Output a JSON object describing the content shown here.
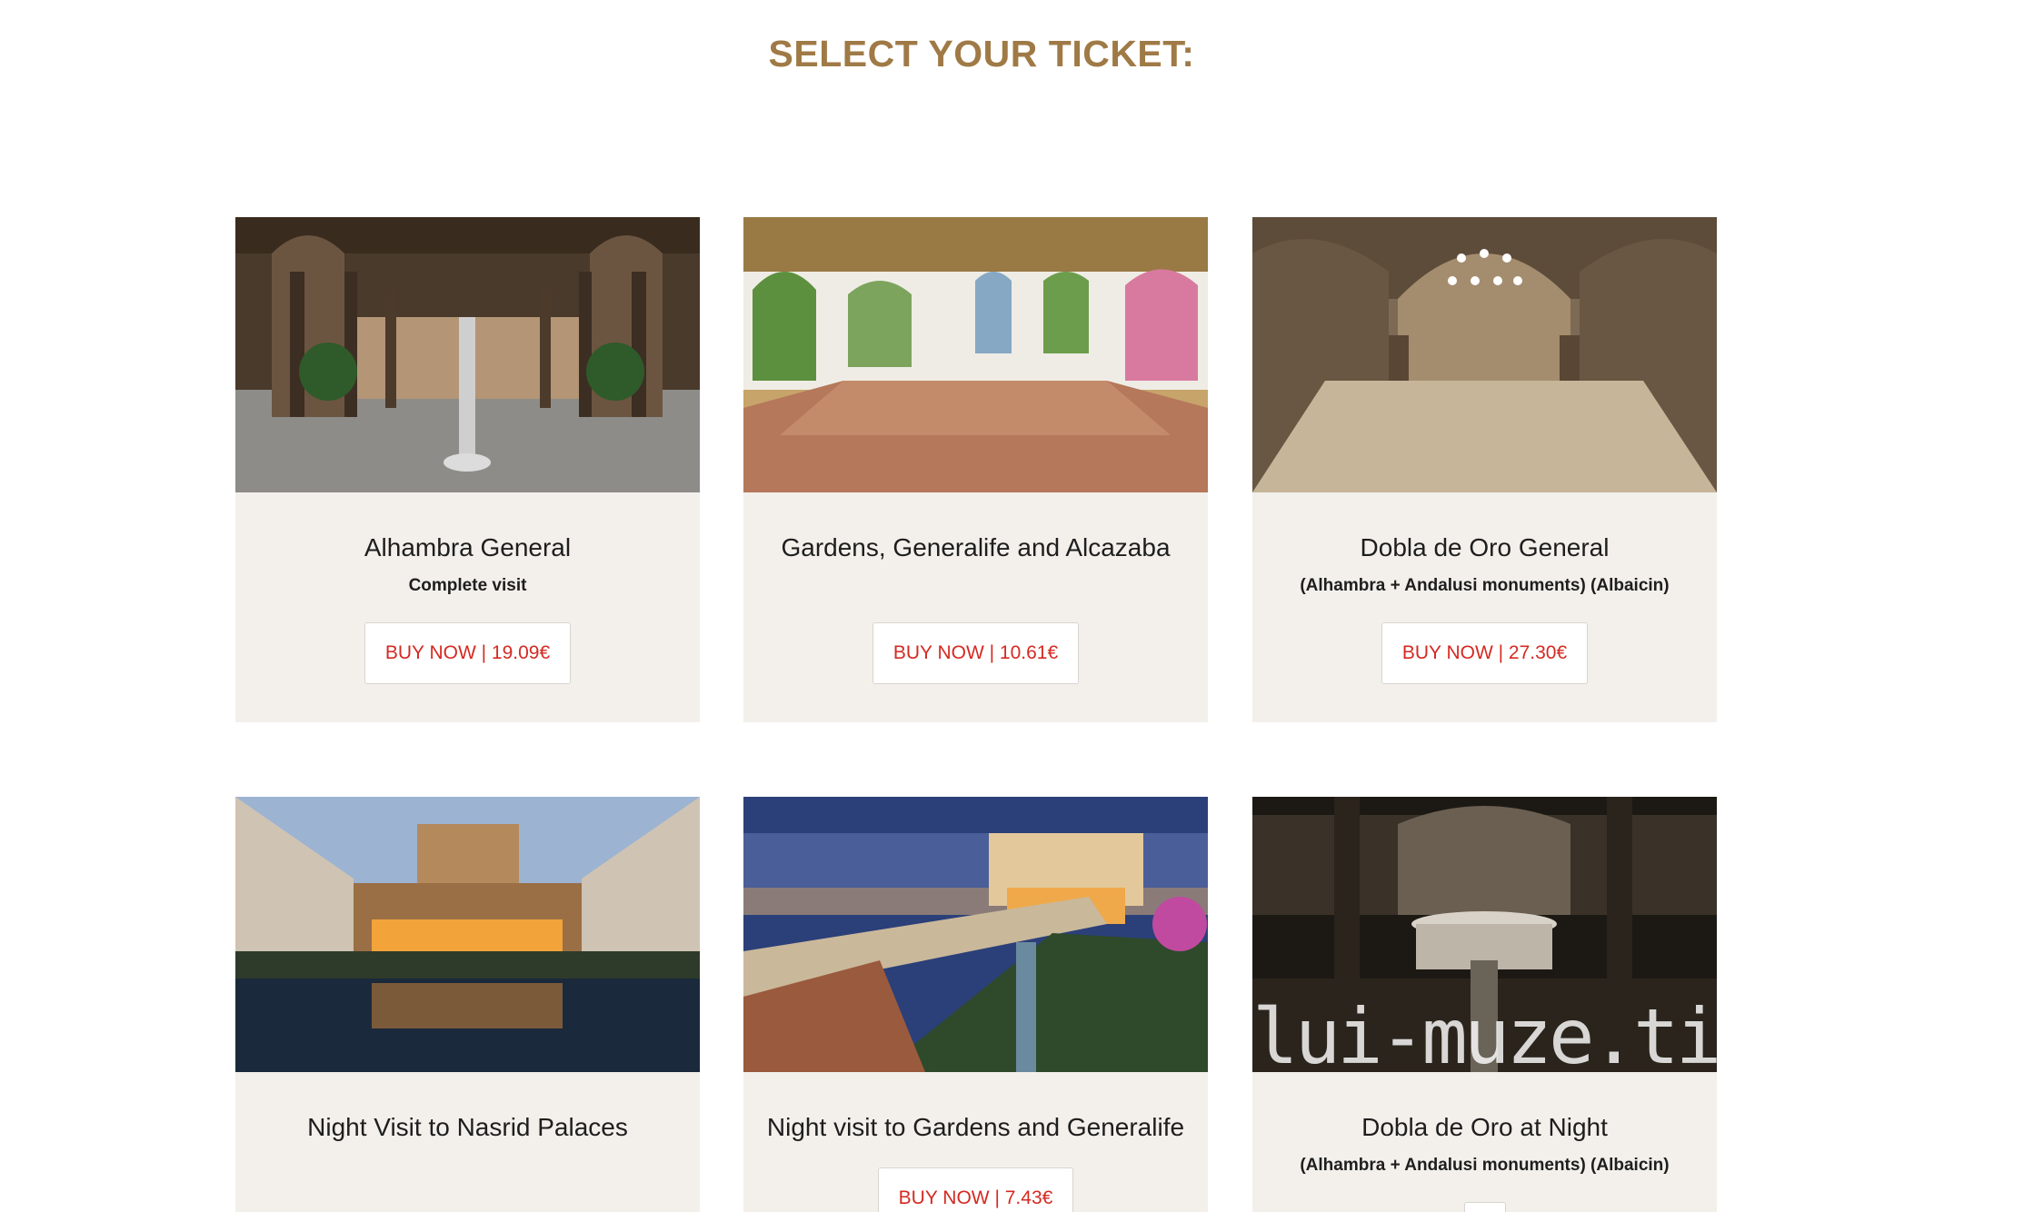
{
  "page": {
    "heading": "SELECT YOUR TICKET:"
  },
  "cards": [
    {
      "title": "Alhambra General",
      "subtitle": "Complete visit",
      "button_label": "BUY NOW | 19.09€",
      "image": "courtyard-of-the-lions-photo"
    },
    {
      "title": "Gardens, Generalife and Alcazaba",
      "subtitle": "",
      "button_label": "BUY NOW | 10.61€",
      "image": "arched-windows-gallery-photo"
    },
    {
      "title": "Dobla de Oro General",
      "subtitle": "(Alhambra + Andalusi monuments) (Albaicin)",
      "button_label": "BUY NOW | 27.30€",
      "image": "arab-baths-photo"
    },
    {
      "title": "Night Visit to Nasrid Palaces",
      "subtitle": "",
      "button_label": "",
      "image": "court-of-myrtles-night-photo"
    },
    {
      "title": "Night visit to Gardens and Generalife",
      "subtitle": "",
      "button_label": "BUY NOW | 7.43€",
      "image": "generalife-dusk-photo"
    },
    {
      "title": "Dobla de Oro at Night",
      "subtitle": "(Alhambra + Andalusi monuments) (Albaicin)",
      "button_label": "",
      "image": "lions-fountain-night-photo",
      "watermark": "lui-muze.tist"
    }
  ],
  "colors": {
    "heading": "#a07a46",
    "card_bg": "#f3f0ec",
    "button_text": "#d42a22"
  }
}
